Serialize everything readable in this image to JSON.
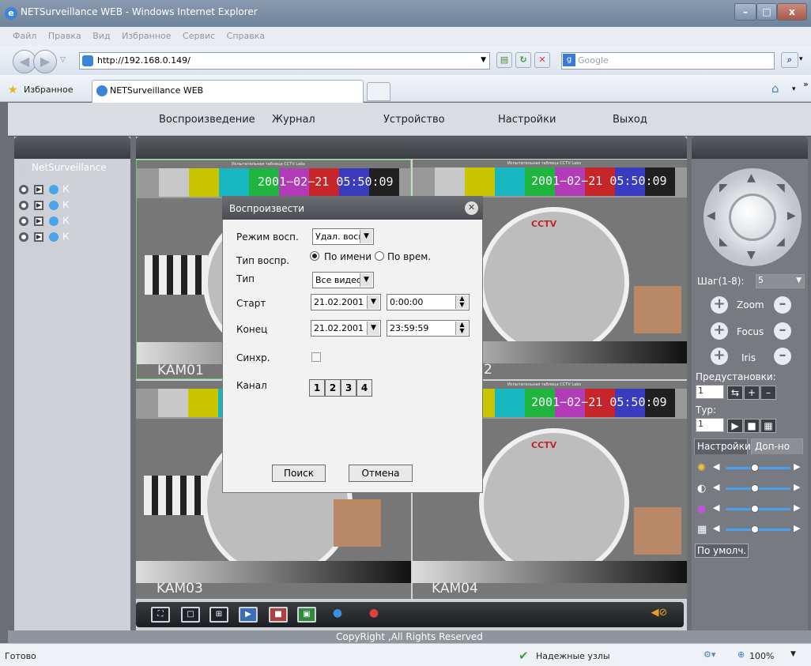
{
  "browser": {
    "title": "NETSurveillance WEB - Windows Internet Explorer",
    "menu": [
      "Файл",
      "Правка",
      "Вид",
      "Избранное",
      "Сервис",
      "Справка"
    ],
    "address": "http://192.168.0.149/",
    "search_placeholder": "Google",
    "favorites_label": "Избранное",
    "tab_title": "NETSurveillance WEB"
  },
  "app_menu": [
    "Воспроизведение",
    "Журнал",
    "Устройство",
    "Настройки",
    "Выход"
  ],
  "left_panel": {
    "root": "NetSurveillance",
    "channels": [
      "К",
      "К",
      "К",
      "К"
    ]
  },
  "video": {
    "tiles": [
      {
        "timestamp": "2001−02−21  05:50:09",
        "label": "KAM01",
        "subtitle": "Испытательная таблица CCTV Labs"
      },
      {
        "timestamp": "2001−02−21  05:50:09",
        "label": "2",
        "subtitle": "Испытательная таблица CCTV Labs"
      },
      {
        "timestamp": "",
        "label": "KAM03",
        "subtitle": ""
      },
      {
        "timestamp": "2001−02−21  05:50:09",
        "label": "KAM04",
        "subtitle": "Испытательная таблица CCTV Labs"
      }
    ],
    "brand": "CCTV"
  },
  "right_panel": {
    "step_label": "Шаг(1-8):",
    "step_value": "5",
    "zoom": "Zoom",
    "focus": "Focus",
    "iris": "Iris",
    "presets_label": "Предустановки:",
    "preset_value": "1",
    "tour_label": "Тур:",
    "tour_value": "1",
    "tab_settings": "Настройки",
    "tab_extra": "Доп-но",
    "default_button": "По умолч.",
    "sliders": [
      {
        "icon": "brightness-icon",
        "level": 0.45
      },
      {
        "icon": "contrast-icon",
        "level": 0.45
      },
      {
        "icon": "color-icon",
        "level": 0.45
      },
      {
        "icon": "saturation-icon",
        "level": 0.45
      }
    ]
  },
  "dialog": {
    "title": "Воспроизвести",
    "mode_label": "Режим восп.",
    "mode_value": "Удал. восп",
    "type_label": "Тип воспр.",
    "type_opt1": "По имени",
    "type_opt2": "По врем.",
    "kind_label": "Тип",
    "kind_value": "Все видео",
    "start_label": "Старт",
    "start_date": "21.02.2001",
    "start_time": "0:00:00",
    "end_label": "Конец",
    "end_date": "21.02.2001",
    "end_time": "23:59:59",
    "sync_label": "Синхр.",
    "channel_label": "Канал",
    "channels": [
      "1",
      "2",
      "3",
      "4"
    ],
    "search_button": "Поиск",
    "cancel_button": "Отмена"
  },
  "footer": {
    "copyright": "CopyRight ,All Rights Reserved"
  },
  "status": {
    "left": "Готово",
    "zone": "Надежные узлы",
    "zoom": "100%"
  }
}
